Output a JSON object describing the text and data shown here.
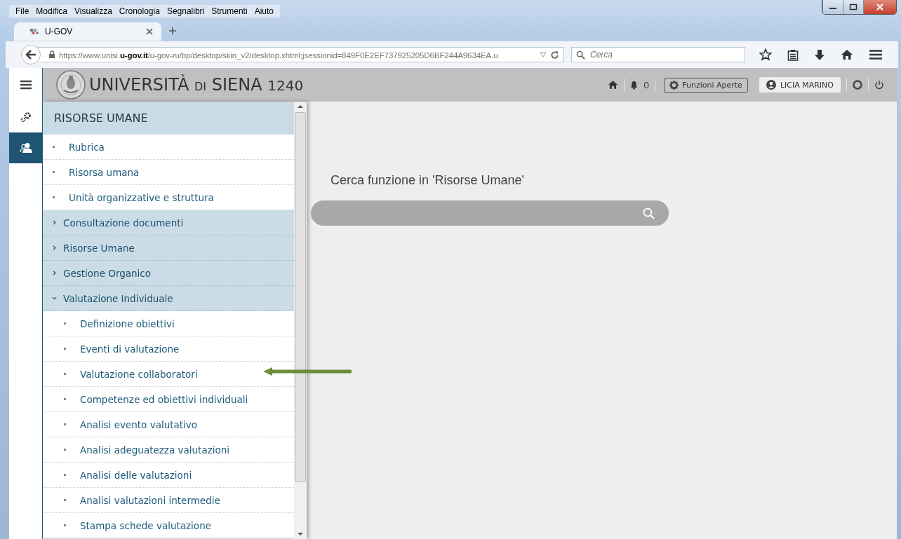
{
  "menu_bar": [
    "File",
    "Modifica",
    "Visualizza",
    "Cronologia",
    "Segnalibri",
    "Strumenti",
    "Aiuto"
  ],
  "tabs": [
    {
      "label": "U-GOV",
      "selected": true
    }
  ],
  "nav_bar": {
    "url": "https://www.unisi.**u-gov.it**/u-gov-ru/bp/desktop/skin_v2/desktop.xhtml;jsessionid=849F0E2EF737925205D6BF244A9634EA.u",
    "search_placeholder": "Cerca"
  },
  "header": {
    "logo_words": [
      {
        "text": "UNIVERSITÀ",
        "kind": "large"
      },
      {
        "text": "DI",
        "kind": "small"
      },
      {
        "text": "SIENA",
        "kind": "large"
      },
      {
        "text": "1240",
        "kind": "medium"
      }
    ],
    "notification_count": "0",
    "open_functions": "Funzioni Aperte",
    "user": "LICIA MARINO"
  },
  "app_sidebar": [
    {
      "kind": "settings",
      "selected": false
    },
    {
      "kind": "people",
      "selected": true
    }
  ],
  "menu": {
    "title": "RISORSE UMANE",
    "items": [
      {
        "kind": "link",
        "label": "Rubrica"
      },
      {
        "kind": "link",
        "label": "Risorsa umana"
      },
      {
        "kind": "link",
        "label": "Unità organizzative e struttura"
      },
      {
        "kind": "group",
        "label": "Consultazione documenti",
        "expanded": false
      },
      {
        "kind": "group",
        "label": "Risorse Umane",
        "expanded": false
      },
      {
        "kind": "group",
        "label": "Gestione Organico",
        "expanded": false
      },
      {
        "kind": "group",
        "label": "Valutazione Individuale",
        "expanded": true,
        "children": [
          {
            "kind": "link",
            "label": "Definizione obiettivi"
          },
          {
            "kind": "link",
            "label": "Eventi di valutazione"
          },
          {
            "kind": "link",
            "label": "Valutazione collaboratori"
          },
          {
            "kind": "link",
            "label": "Competenze ed obiettivi individuali"
          },
          {
            "kind": "link",
            "label": "Analisi evento valutativo"
          },
          {
            "kind": "link",
            "label": "Analisi adeguatezza valutazioni"
          },
          {
            "kind": "link",
            "label": "Analisi delle valutazioni"
          },
          {
            "kind": "link",
            "label": "Analisi valutazioni intermedie"
          },
          {
            "kind": "link",
            "label": "Stampa schede valutazione"
          }
        ]
      }
    ]
  },
  "content": {
    "search_title": "Cerca funzione in 'Risorse Umane'"
  }
}
